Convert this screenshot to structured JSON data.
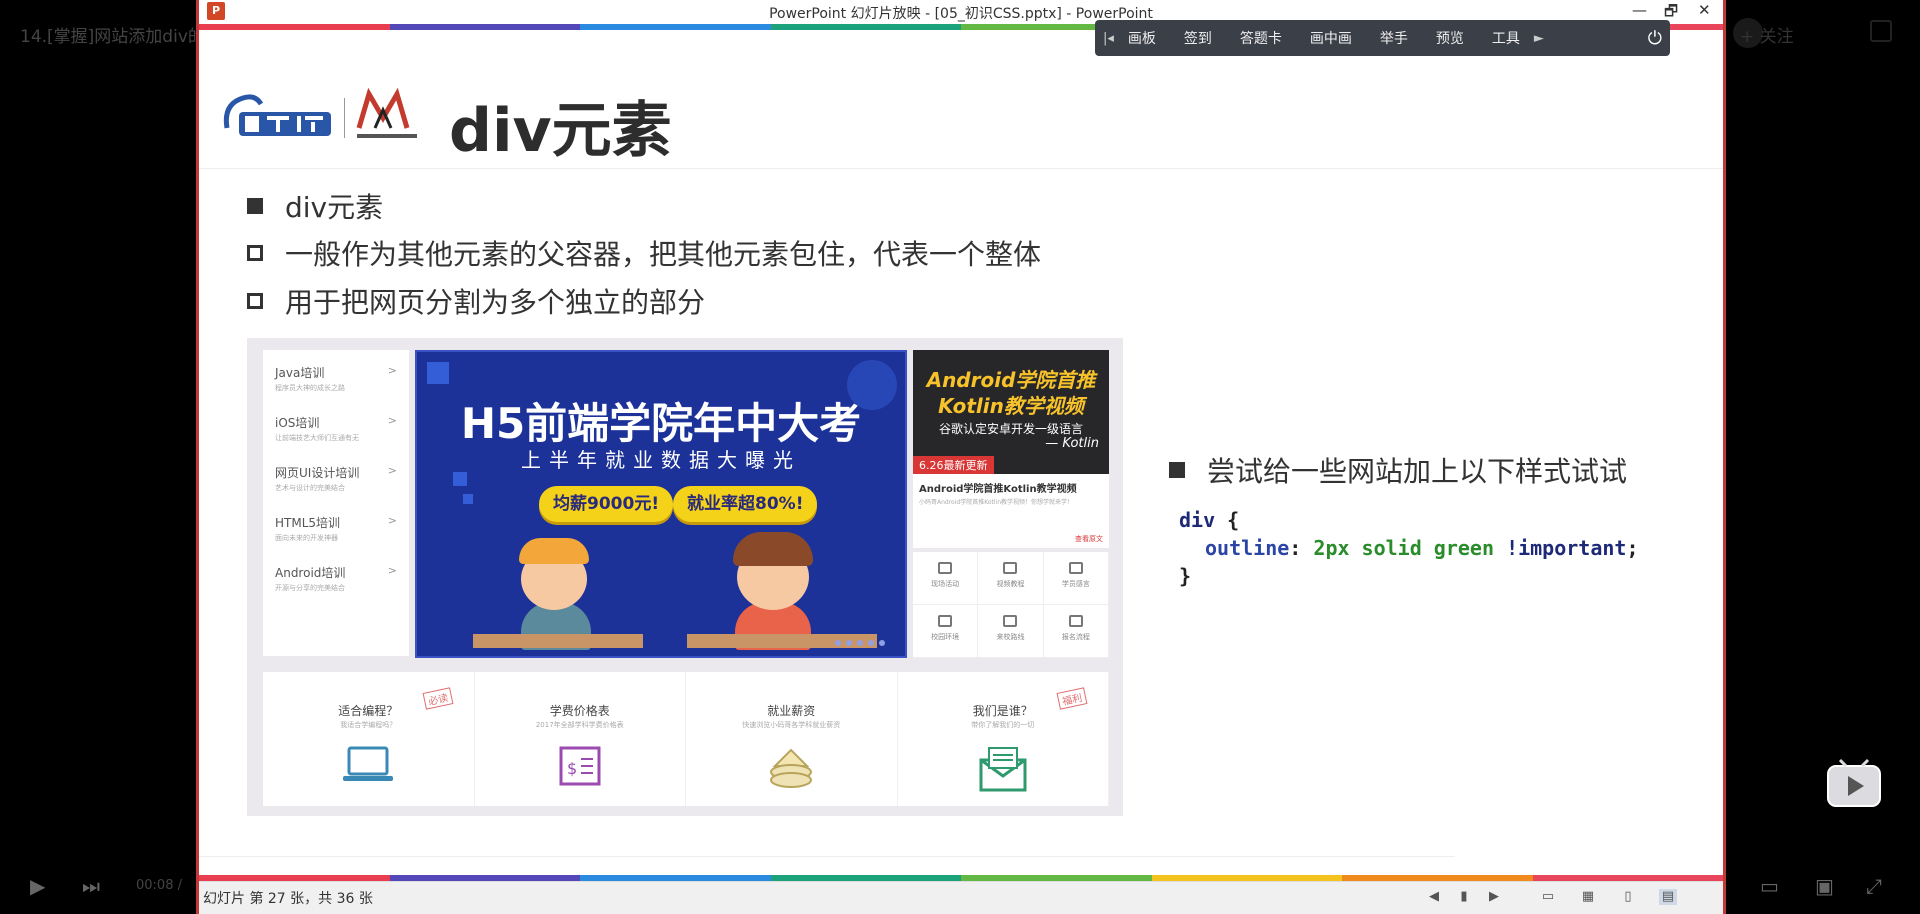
{
  "player": {
    "video_title": "14.[掌握]网站添加div的",
    "follow_label": "+ 关注",
    "time": "00:08 / "
  },
  "ppt": {
    "window_title": "PowerPoint 幻灯片放映 - [05_初识CSS.pptx] - PowerPoint",
    "logo_letter": "P",
    "window_buttons": [
      "—",
      "🗗",
      "✕"
    ],
    "toolbar": {
      "items": [
        "画板",
        "签到",
        "答题卡",
        "画中画",
        "举手",
        "预览",
        "工具"
      ]
    },
    "status": "幻灯片 第 27 张，共 36 张"
  },
  "slide": {
    "title": "div元素",
    "bullets": [
      {
        "text": "div元素",
        "style": "filled"
      },
      {
        "text": "一般作为其他元素的父容器，把其他元素包住，代表一个整体",
        "style": "hollow"
      },
      {
        "text": "用于把网页分割为多个独立的部分",
        "style": "hollow"
      }
    ],
    "right_bullet": "尝试给一些网站加上以下样式试试",
    "code": {
      "line1_selector": "div",
      "line1_brace": " {",
      "line2_prop": "outline",
      "line2_colon": ": ",
      "line2_num": "2",
      "line2_unit": "px solid green ",
      "line2_imp": "!important",
      "line2_end": ";",
      "line3": "}"
    }
  },
  "site": {
    "menu": [
      {
        "title": "Java培训",
        "sub": "程序员大神的成长之路"
      },
      {
        "title": "iOS培训",
        "sub": "让前端技艺大师们互通有无"
      },
      {
        "title": "网页UI设计培训",
        "sub": "艺术与设计的完美结合"
      },
      {
        "title": "HTML5培训",
        "sub": "面向未来的开发神器"
      },
      {
        "title": "Android培训",
        "sub": "开源与分享的完美结合"
      }
    ],
    "banner": {
      "title": "H5前端学院年中大考",
      "subtitle": "上半年就业数据大曝光",
      "pill1": "均薪9000元!",
      "pill2": "就业率超80%!"
    },
    "kotlin": {
      "line1": "Android学院首推",
      "line2": "Kotlin教学视频",
      "line3": "谷歌认定安卓开发一级语言",
      "line4": "— Kotlin",
      "badge": "6.26最新更新",
      "caption": "Android学院首推Kotlin教学视频",
      "desc": "小码哥Android学院首推Kotlin教学视频！你想学就来学！",
      "more": "查看原文"
    },
    "quicklinks": [
      "现场活动",
      "视频教程",
      "学员感言",
      "校园环境",
      "来校路线",
      "报名流程"
    ],
    "features": [
      {
        "title": "适合编程？",
        "sub": "我适合学编程吗？",
        "stamp": "必读"
      },
      {
        "title": "学费价格表",
        "sub": "2017年全部学科学费价格表",
        "stamp": ""
      },
      {
        "title": "就业薪资",
        "sub": "快速浏览小码哥各学科就业薪资",
        "stamp": ""
      },
      {
        "title": "我们是谁？",
        "sub": "带你了解我们的一切",
        "stamp": "福利"
      }
    ]
  },
  "colors": {
    "rainbow": [
      "#e83e4f",
      "#5448b8",
      "#2a8ae0",
      "#1ba27a",
      "#63b843",
      "#f5c31d",
      "#f08a1d",
      "#e8455b"
    ],
    "ppt_border": "#c2393a"
  }
}
